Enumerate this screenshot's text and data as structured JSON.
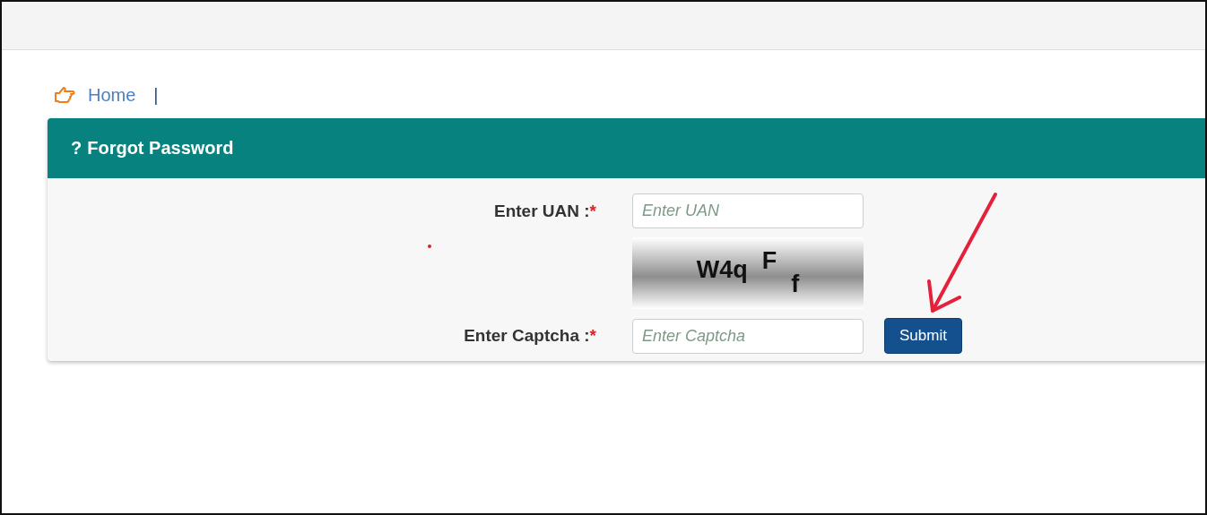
{
  "breadcrumb": {
    "items": [
      "Home"
    ],
    "separator": "|"
  },
  "panel": {
    "icon": "?",
    "title": "Forgot Password"
  },
  "form": {
    "uan": {
      "label": "Enter UAN :",
      "required": "*",
      "placeholder": "Enter UAN"
    },
    "captcha_image": [
      "W4q",
      "F",
      "f"
    ],
    "captcha": {
      "label": "Enter Captcha :",
      "required": "*",
      "placeholder": "Enter Captcha"
    },
    "submit": "Submit"
  }
}
